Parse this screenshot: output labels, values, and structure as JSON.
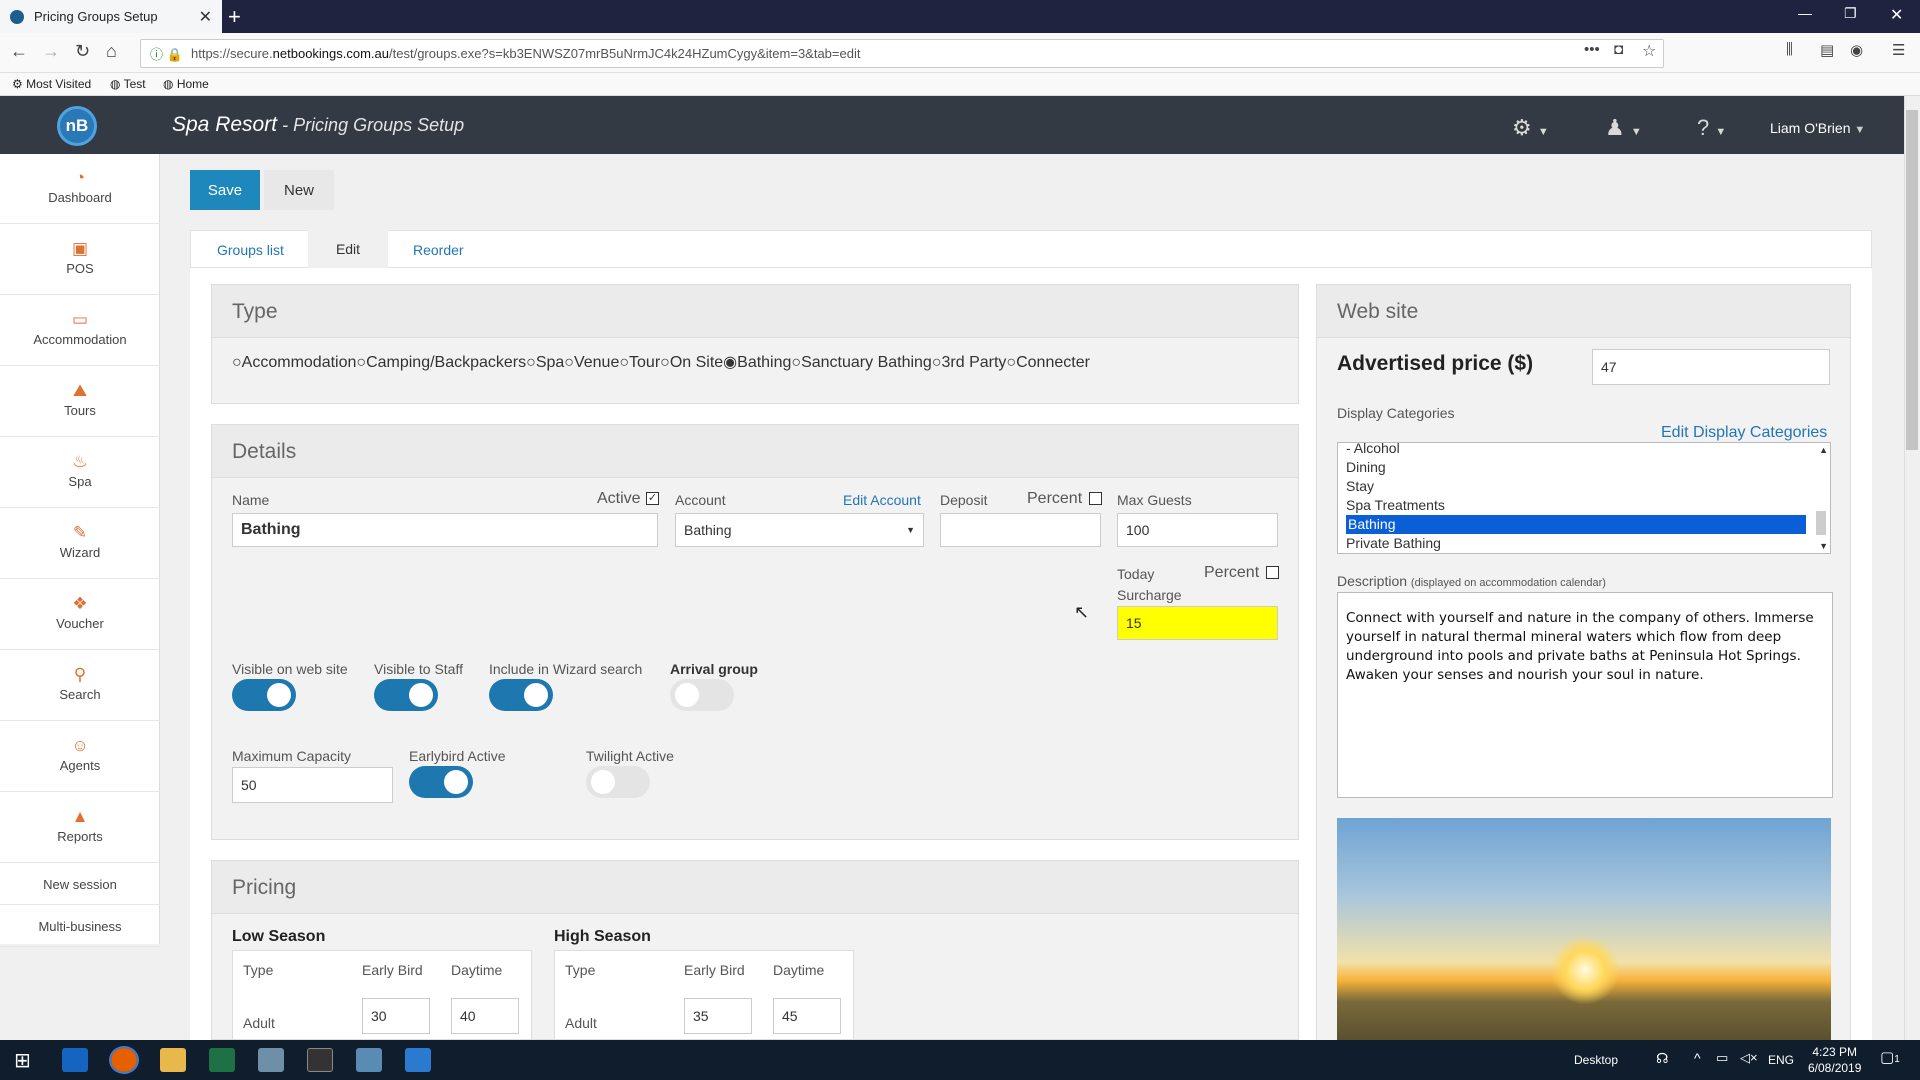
{
  "browser": {
    "tab_title": "Pricing Groups Setup",
    "url_prefix": "https://secure.",
    "url_domain": "netbookings.com.au",
    "url_rest": "/test/groups.exe?s=kb3ENWSZ07mrB5uNrmJC4k24HZumCygy&item=3&tab=edit",
    "bookmarks": [
      "Most Visited",
      "Test",
      "Home"
    ]
  },
  "header": {
    "logo": "nB",
    "business": "Spa Resort",
    "separator": " - ",
    "page": "Pricing Groups Setup",
    "user": "Liam O'Brien"
  },
  "sidebar": {
    "items": [
      {
        "label": "Dashboard",
        "icon": "dashboard-icon"
      },
      {
        "label": "POS",
        "icon": "pos-icon"
      },
      {
        "label": "Accommodation",
        "icon": "bed-icon"
      },
      {
        "label": "Tours",
        "icon": "tours-icon"
      },
      {
        "label": "Spa",
        "icon": "spa-icon"
      },
      {
        "label": "Wizard",
        "icon": "wand-icon"
      },
      {
        "label": "Voucher",
        "icon": "gift-icon"
      },
      {
        "label": "Search",
        "icon": "search-icon"
      },
      {
        "label": "Agents",
        "icon": "agent-icon"
      },
      {
        "label": "Reports",
        "icon": "chart-icon"
      }
    ],
    "links": [
      "New session",
      "Multi-business"
    ]
  },
  "toolbar": {
    "save": "Save",
    "new": "New"
  },
  "tabs": {
    "groups_list": "Groups list",
    "edit": "Edit",
    "reorder": "Reorder"
  },
  "type_panel": {
    "title": "Type",
    "options": [
      "Accommodation",
      "Camping/Backpackers",
      "Spa",
      "Venue",
      "Tour",
      "On Site",
      "Bathing",
      "Sanctuary Bathing",
      "3rd Party",
      "Connecter"
    ],
    "selected": "Bathing"
  },
  "details": {
    "title": "Details",
    "name_label": "Name",
    "name_value": "Bathing",
    "active_label": "Active",
    "active_checked": true,
    "account_label": "Account",
    "edit_account": "Edit Account",
    "account_value": "Bathing",
    "deposit_label": "Deposit",
    "deposit_value": "",
    "percent_label": "Percent",
    "max_guests_label": "Max Guests",
    "max_guests_value": "100",
    "today_label": "Today",
    "surcharge_label": "Surcharge",
    "surcharge_value": "15",
    "visible_web_label": "Visible on web site",
    "visible_staff_label": "Visible to Staff",
    "wizard_label": "Include in Wizard search",
    "arrival_label": "Arrival group",
    "max_capacity_label": "Maximum Capacity",
    "max_capacity_value": "50",
    "earlybird_label": "Earlybird Active",
    "twilight_label": "Twilight Active",
    "toggles": {
      "visible_web": true,
      "visible_staff": true,
      "wizard": true,
      "arrival": false,
      "earlybird": true,
      "twilight": false
    }
  },
  "pricing": {
    "title": "Pricing",
    "low": {
      "title": "Low Season",
      "col_type": "Type",
      "col_early": "Early Bird",
      "col_day": "Daytime",
      "row_label": "Adult",
      "early": "30",
      "day": "40"
    },
    "high": {
      "title": "High Season",
      "col_type": "Type",
      "col_early": "Early Bird",
      "col_day": "Daytime",
      "row_label": "Adult",
      "early": "35",
      "day": "45"
    }
  },
  "website": {
    "title": "Web site",
    "advertised_label": "Advertised price ($)",
    "advertised_value": "47",
    "display_categories_label": "Display Categories",
    "edit_categories": "Edit Display Categories",
    "categories": [
      "- Alcohol",
      "Dining",
      "Stay",
      "Spa Treatments",
      "Bathing",
      "Private Bathing"
    ],
    "selected_category": "Bathing",
    "description_label": "Description",
    "description_note": "(displayed on accommodation calendar)",
    "description": "Connect with yourself and nature in the company of others. Immerse yourself in natural thermal mineral waters which flow from deep underground into pools and private baths at Peninsula Hot Springs. Awaken your senses and nourish your soul in nature."
  },
  "taskbar": {
    "desktop": "Desktop",
    "lang": "ENG",
    "time": "4:23 PM",
    "date": "6/08/2019",
    "notif": "1"
  }
}
